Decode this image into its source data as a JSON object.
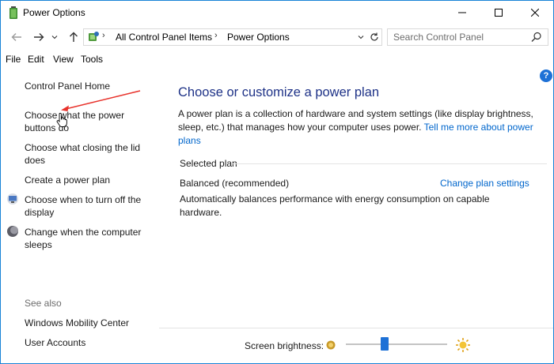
{
  "window": {
    "title": "Power Options",
    "icon": "power-options-battery-icon"
  },
  "nav": {
    "back_icon": "arrow-left-icon",
    "forward_icon": "arrow-right-icon",
    "recent_icon": "chevron-down-icon",
    "up_icon": "arrow-up-icon",
    "breadcrumbs": [
      "All Control Panel Items",
      "Power Options"
    ],
    "search_placeholder": "Search Control Panel"
  },
  "menu": {
    "file": "File",
    "edit": "Edit",
    "view": "View",
    "tools": "Tools"
  },
  "sidebar": {
    "home": "Control Panel Home",
    "items": [
      {
        "line1": "Choose what the power",
        "line2": "buttons do",
        "icon": ""
      },
      {
        "line1": "Choose what closing the lid",
        "line2": "does",
        "icon": ""
      },
      {
        "line1": "Create a power plan",
        "line2": "",
        "icon": ""
      },
      {
        "line1": "Choose when to turn off the",
        "line2": "display",
        "icon": "monitor-icon"
      },
      {
        "line1": "Change when the computer",
        "line2": "sleeps",
        "icon": "moon-icon"
      }
    ],
    "see_also_label": "See also",
    "see_also": [
      "Windows Mobility Center",
      "User Accounts"
    ]
  },
  "main": {
    "heading": "Choose or customize a power plan",
    "description_line1": "A power plan is a collection of hardware and system settings (like display brightness,",
    "description_line2": "sleep, etc.) that manages how your computer uses power.",
    "learn_more_link": "Tell me more about power plans",
    "selected_plan_label": "Selected plan",
    "plan_name": "Balanced (recommended)",
    "change_plan_link": "Change plan settings",
    "plan_description": "Automatically balances performance with energy consumption on capable hardware."
  },
  "brightness": {
    "label": "Screen brightness:",
    "level_fraction": 0.38
  },
  "colors": {
    "accent": "#1e71d6",
    "link": "#0066cc",
    "heading": "#1e3287",
    "annotation": "#e8322b"
  }
}
